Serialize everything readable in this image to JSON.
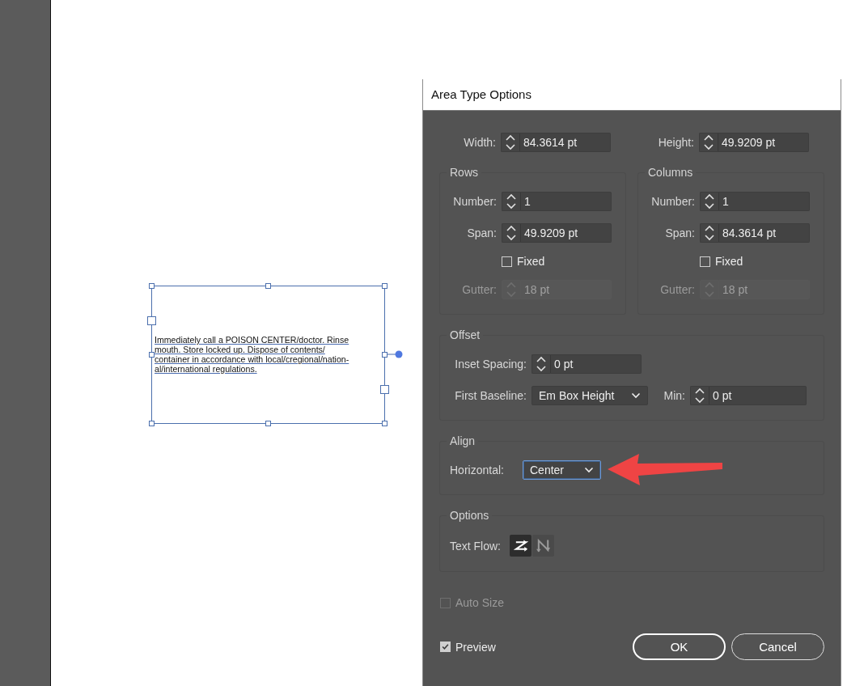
{
  "canvas": {
    "text_frame": {
      "lines": [
        "Immediately call a POISON CENTER/doctor. Rinse",
        "mouth. Store locked up. Dispose of contents/",
        "container in accordance with local/cregional/nation-",
        "al/international regulations."
      ]
    }
  },
  "dialog": {
    "title": "Area Type Options",
    "size": [
      {
        "label": "Width:",
        "value": "84.3614 pt"
      },
      {
        "label": "Height:",
        "value": "49.9209 pt"
      }
    ],
    "groups": [
      {
        "title": "Rows",
        "number": {
          "label": "Number:",
          "value": "1"
        },
        "span": {
          "label": "Span:",
          "value": "49.9209 pt"
        },
        "fixed": {
          "label": "Fixed",
          "checked": false
        },
        "gutter": {
          "label": "Gutter:",
          "value": "18 pt",
          "disabled": true
        }
      },
      {
        "title": "Columns",
        "number": {
          "label": "Number:",
          "value": "1"
        },
        "span": {
          "label": "Span:",
          "value": "84.3614 pt"
        },
        "fixed": {
          "label": "Fixed",
          "checked": false
        },
        "gutter": {
          "label": "Gutter:",
          "value": "18 pt",
          "disabled": true
        }
      }
    ],
    "offset": {
      "title": "Offset",
      "inset_spacing": {
        "label": "Inset Spacing:",
        "value": "0 pt"
      },
      "first_baseline": {
        "label": "First Baseline:",
        "value": "Em Box Height"
      },
      "min": {
        "label": "Min:",
        "value": "0 pt"
      }
    },
    "align": {
      "title": "Align",
      "horizontal": {
        "label": "Horizontal:",
        "value": "Center",
        "focused": true
      }
    },
    "options": {
      "title": "Options",
      "text_flow": {
        "label": "Text Flow:",
        "buttons": [
          {
            "kind": "rows-first",
            "selected": true
          },
          {
            "kind": "columns-first",
            "selected": false
          }
        ]
      }
    },
    "auto_size": {
      "label": "Auto Size",
      "checked": false,
      "disabled": true
    },
    "preview": {
      "label": "Preview",
      "checked": true,
      "disabled": false
    },
    "buttons": [
      {
        "label": "OK",
        "default": true
      },
      {
        "label": "Cancel",
        "default": false
      }
    ]
  }
}
